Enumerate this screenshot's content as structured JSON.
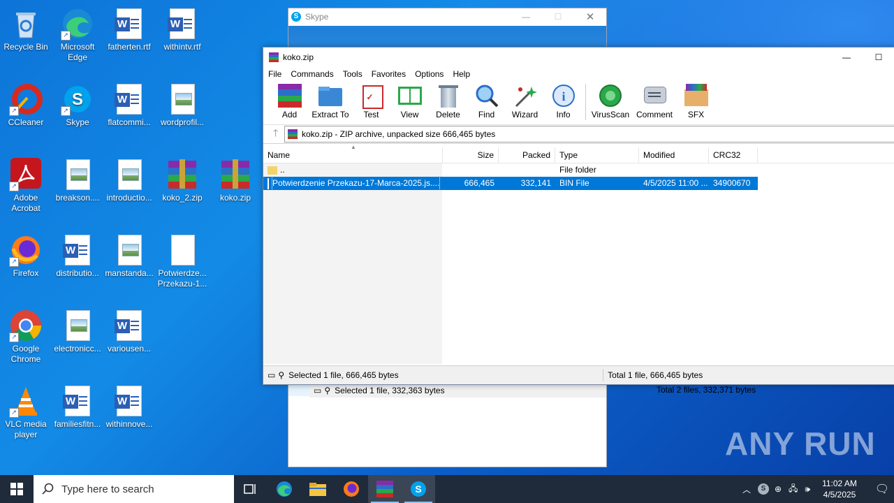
{
  "desktop_icons": [
    {
      "label": "Recycle Bin",
      "icon": "recycle-bin-icon"
    },
    {
      "label": "Microsoft Edge",
      "icon": "edge-icon"
    },
    {
      "label": "fatherten.rtf",
      "icon": "word-doc-icon"
    },
    {
      "label": "withintv.rtf",
      "icon": "word-doc-icon"
    },
    {
      "label": "CCleaner",
      "icon": "ccleaner-icon"
    },
    {
      "label": "Skype",
      "icon": "skype-icon"
    },
    {
      "label": "flatcommi...",
      "icon": "word-doc-icon"
    },
    {
      "label": "wordprofil...",
      "icon": "image-file-icon"
    },
    {
      "label": "Adobe Acrobat",
      "icon": "acrobat-icon"
    },
    {
      "label": "breakson....",
      "icon": "image-file-icon"
    },
    {
      "label": "introductio...",
      "icon": "image-file-icon"
    },
    {
      "label": "koko_2.zip",
      "icon": "winrar-archive-icon"
    },
    {
      "label": "koko.zip",
      "icon": "winrar-archive-icon"
    },
    {
      "label": "Firefox",
      "icon": "firefox-icon"
    },
    {
      "label": "distributio...",
      "icon": "word-doc-icon"
    },
    {
      "label": "manstanda...",
      "icon": "image-file-icon"
    },
    {
      "label": "Potwierdze... Przekazu-1...",
      "icon": "blank-file-icon"
    },
    {
      "label": "Google Chrome",
      "icon": "chrome-icon"
    },
    {
      "label": "electronicc...",
      "icon": "image-file-icon"
    },
    {
      "label": "variousen...",
      "icon": "word-doc-icon"
    },
    {
      "label": "VLC media player",
      "icon": "vlc-icon"
    },
    {
      "label": "familiesfitn...",
      "icon": "word-doc-icon"
    },
    {
      "label": "withinnove...",
      "icon": "word-doc-icon"
    }
  ],
  "skype_window": {
    "title": "Skype",
    "status_left": "Selected 1 file, 332,363 bytes",
    "status_right": "Total 2 files, 332,371 bytes"
  },
  "winrar": {
    "title": "koko.zip",
    "menu": [
      "File",
      "Commands",
      "Tools",
      "Favorites",
      "Options",
      "Help"
    ],
    "toolbar": [
      {
        "label": "Add",
        "icon": "add-icon"
      },
      {
        "label": "Extract To",
        "icon": "extract-icon"
      },
      {
        "label": "Test",
        "icon": "test-icon"
      },
      {
        "label": "View",
        "icon": "view-icon"
      },
      {
        "label": "Delete",
        "icon": "delete-icon"
      },
      {
        "label": "Find",
        "icon": "find-icon"
      },
      {
        "label": "Wizard",
        "icon": "wizard-icon"
      },
      {
        "label": "Info",
        "icon": "info-icon"
      },
      {
        "label": "VirusScan",
        "icon": "virusscan-icon"
      },
      {
        "label": "Comment",
        "icon": "comment-icon"
      },
      {
        "label": "SFX",
        "icon": "sfx-icon"
      }
    ],
    "address": "koko.zip - ZIP archive, unpacked size 666,465 bytes",
    "columns": [
      "Name",
      "Size",
      "Packed",
      "Type",
      "Modified",
      "CRC32"
    ],
    "rows": [
      {
        "name": "..",
        "size": "",
        "packed": "",
        "type": "File folder",
        "modified": "",
        "crc": ""
      },
      {
        "name": "Potwierdzenie Przekazu-17-Marca-2025.js....",
        "size": "666,465",
        "packed": "332,141",
        "type": "BIN File",
        "modified": "4/5/2025 11:00 ...",
        "crc": "34900670"
      }
    ],
    "status_left": "Selected 1 file, 666,465 bytes",
    "status_right": "Total 1 file, 666,465 bytes"
  },
  "taskbar": {
    "search_placeholder": "Type here to search",
    "time": "11:02 AM",
    "date": "4/5/2025"
  },
  "watermark": "ANY RUN",
  "colors": {
    "selection": "#0078d7",
    "taskbar": "#1f2b3a"
  }
}
